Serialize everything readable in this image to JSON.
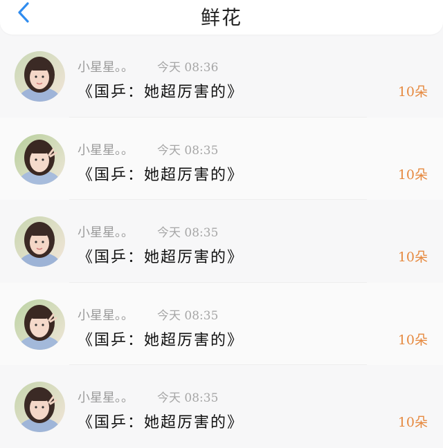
{
  "header": {
    "title": "鲜花",
    "back_icon": "chevron-left-icon",
    "accent": "#2f8cef"
  },
  "items": [
    {
      "name": "小星星。。",
      "time": "今天 08:36",
      "text": "《国乒：她超厉害的》",
      "count": "10朵"
    },
    {
      "name": "小星星。。",
      "time": "今天 08:35",
      "text": "《国乒：她超厉害的》",
      "count": "10朵"
    },
    {
      "name": "小星星。。",
      "time": "今天 08:35",
      "text": "《国乒：她超厉害的》",
      "count": "10朵"
    },
    {
      "name": "小星星。。",
      "time": "今天 08:35",
      "text": "《国乒：她超厉害的》",
      "count": "10朵"
    },
    {
      "name": "小星星。。",
      "time": "今天 08:35",
      "text": "《国乒：她超厉害的》",
      "count": "10朵"
    }
  ],
  "colors": {
    "count": "#e6893f",
    "name": "#9b9b9b"
  }
}
